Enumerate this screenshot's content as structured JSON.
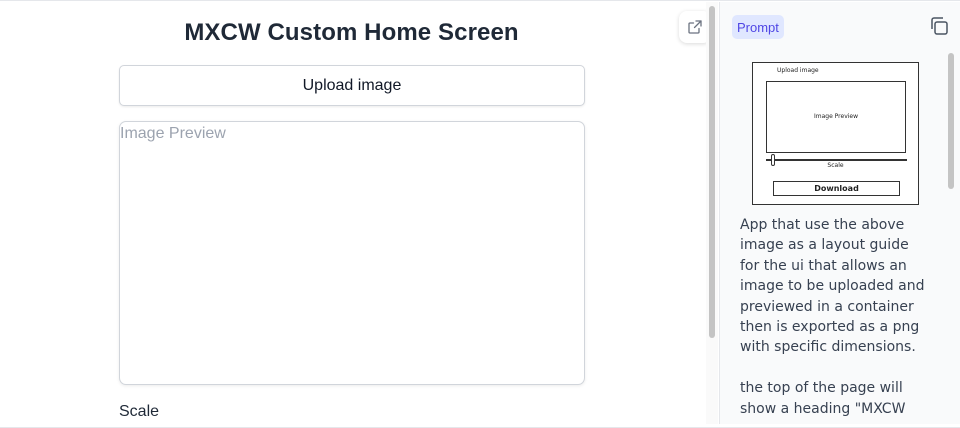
{
  "app": {
    "title": "MXCW Custom Home Screen",
    "upload_label": "Upload image",
    "preview_placeholder": "Image Preview",
    "scale_label": "Scale"
  },
  "prompt_panel": {
    "badge": "Prompt",
    "sketch": {
      "upload_label": "Upload image",
      "preview_label": "Image Preview",
      "scale_label": "Scale",
      "download_label": "Download"
    },
    "paragraph_1": "App that use the above image as a layout guide for the ui that allows an image to be uploaded and previewed in a container then is exported as a png with specific dimensions.",
    "paragraph_2": "the top of the page will show a heading \"MXCW"
  },
  "icons": {
    "open_external": "external-link-icon",
    "copy": "copy-icon"
  },
  "colors": {
    "badge_bg": "#e0e7ff",
    "badge_text": "#4f46e5",
    "placeholder": "#9ca3af"
  }
}
